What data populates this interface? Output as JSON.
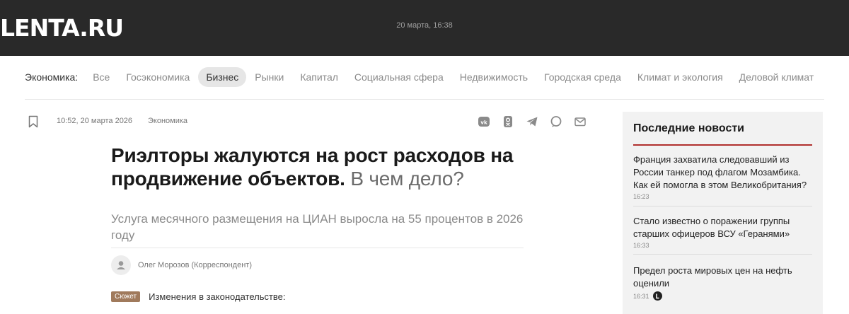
{
  "header": {
    "logo_text": "LENTA.RU",
    "date": "20 марта, 16:38"
  },
  "rubrics": {
    "title": "Экономика:",
    "tabs": [
      {
        "label": "Все",
        "active": false
      },
      {
        "label": "Госэкономика",
        "active": false
      },
      {
        "label": "Бизнес",
        "active": true
      },
      {
        "label": "Рынки",
        "active": false
      },
      {
        "label": "Капитал",
        "active": false
      },
      {
        "label": "Социальная сфера",
        "active": false
      },
      {
        "label": "Недвижимость",
        "active": false
      },
      {
        "label": "Городская среда",
        "active": false
      },
      {
        "label": "Климат и экология",
        "active": false
      },
      {
        "label": "Деловой климат",
        "active": false
      }
    ]
  },
  "article": {
    "time": "10:52, 20 марта 2026",
    "rubric": "Экономика",
    "title_main": "Риэлторы жалуются на рост расходов на продвижение объектов.",
    "title_sub": "В чем дело?",
    "lead": "Услуга месячного размещения на ЦИАН выросла на 55 процентов в 2026 году",
    "author": "Олег Морозов (Корреспондент)",
    "story_badge": "Сюжет",
    "story_text": "Изменения в законодательстве:",
    "share_icons": [
      "vk-icon",
      "ok-icon",
      "telegram-icon",
      "max-icon",
      "mail-icon"
    ]
  },
  "sidebar": {
    "title": "Последние новости",
    "items": [
      {
        "title": "Франция захватила следовавший из России танкер под флагом Мозамбика. Как ей помогла в этом Великобритания?",
        "time": "16:23",
        "live": false
      },
      {
        "title": "Стало известно о поражении группы старших офицеров ВСУ «Геранями»",
        "time": "16:33",
        "live": false
      },
      {
        "title": "Предел роста мировых цен на нефть оценили",
        "time": "16:31",
        "live": true
      }
    ]
  },
  "colors": {
    "topbar": "#292929",
    "accent_red": "#b0302e",
    "story_badge": "#a07a5c",
    "sidebar_bg": "#f2f2f2"
  }
}
